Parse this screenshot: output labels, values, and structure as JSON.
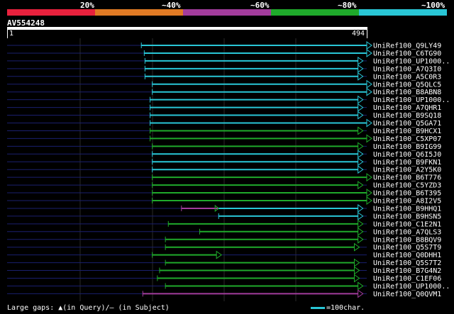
{
  "header": {
    "pct_labels": [
      "20%",
      "~40%",
      "~60%",
      "~80%",
      "~100%"
    ],
    "bands": [
      "#e8213d",
      "#e07a24",
      "#a23c9c",
      "#1faa2b",
      "#29c6d6"
    ]
  },
  "query": {
    "name": "AV554248",
    "start": "1",
    "end": "494",
    "length": 494
  },
  "colors": {
    "cyan": "#29c6d6",
    "green": "#1faa2b",
    "purple": "#a23c9c",
    "track": "#1a1f6e"
  },
  "hits": [
    {
      "name": "UniRef100_Q9LY49",
      "start": 185,
      "end": 494,
      "color": "cyan"
    },
    {
      "name": "UniRef100_C6TG90",
      "start": 189,
      "end": 494,
      "color": "cyan"
    },
    {
      "name": "UniRef100_UP1000..",
      "start": 190,
      "end": 482,
      "color": "cyan"
    },
    {
      "name": "UniRef100_A7Q3I0",
      "start": 190,
      "end": 482,
      "color": "cyan"
    },
    {
      "name": "UniRef100_A5C0R3",
      "start": 190,
      "end": 482,
      "color": "cyan"
    },
    {
      "name": "UniRef100_Q5QLC5",
      "start": 200,
      "end": 494,
      "color": "cyan"
    },
    {
      "name": "UniRef100_B8ABN8",
      "start": 200,
      "end": 494,
      "color": "cyan"
    },
    {
      "name": "UniRef100_UP1000..",
      "start": 197,
      "end": 482,
      "color": "cyan"
    },
    {
      "name": "UniRef100_A7QHR1",
      "start": 197,
      "end": 482,
      "color": "cyan"
    },
    {
      "name": "UniRef100_B9SQ18",
      "start": 197,
      "end": 482,
      "color": "cyan"
    },
    {
      "name": "UniRef100_Q5GA71",
      "start": 197,
      "end": 494,
      "color": "cyan"
    },
    {
      "name": "UniRef100_B9HCX1",
      "start": 197,
      "end": 482,
      "color": "green"
    },
    {
      "name": "UniRef100_C5XP07",
      "start": 197,
      "end": 494,
      "color": "green"
    },
    {
      "name": "UniRef100_B9IG99",
      "start": 200,
      "end": 482,
      "color": "green"
    },
    {
      "name": "UniRef100_Q6I5J0",
      "start": 200,
      "end": 482,
      "color": "cyan"
    },
    {
      "name": "UniRef100_B9FKN1",
      "start": 200,
      "end": 482,
      "color": "cyan"
    },
    {
      "name": "UniRef100_A2Y5K0",
      "start": 200,
      "end": 482,
      "color": "cyan"
    },
    {
      "name": "UniRef100_B6T776",
      "start": 200,
      "end": 494,
      "color": "green"
    },
    {
      "name": "UniRef100_C5YZD3",
      "start": 200,
      "end": 482,
      "color": "green"
    },
    {
      "name": "UniRef100_B6T395",
      "start": 200,
      "end": 494,
      "color": "green"
    },
    {
      "name": "UniRef100_A8I2V5",
      "start": 200,
      "end": 494,
      "color": "green"
    },
    {
      "name": "UniRef100_B9HHQ1",
      "start": 240,
      "end": 482,
      "color": "purple-cyan",
      "split": 291
    },
    {
      "name": "UniRef100_B9HSN5",
      "start": 291,
      "end": 482,
      "color": "cyan"
    },
    {
      "name": "UniRef100_C1E2N1",
      "start": 222,
      "end": 482,
      "color": "green"
    },
    {
      "name": "UniRef100_A7QLS3",
      "start": 265,
      "end": 482,
      "color": "green"
    },
    {
      "name": "UniRef100_B8BQV9",
      "start": 218,
      "end": 482,
      "color": "green"
    },
    {
      "name": "UniRef100_Q5S7T9",
      "start": 218,
      "end": 477,
      "color": "green"
    },
    {
      "name": "UniRef100_Q0DHH1",
      "start": 200,
      "end": 288,
      "color": "green"
    },
    {
      "name": "UniRef100_Q5S7T2",
      "start": 218,
      "end": 477,
      "color": "green"
    },
    {
      "name": "UniRef100_B7G4N2",
      "start": 210,
      "end": 477,
      "color": "green"
    },
    {
      "name": "UniRef100_C1EF06",
      "start": 207,
      "end": 477,
      "color": "green"
    },
    {
      "name": "UniRef100_UP1000..",
      "start": 218,
      "end": 482,
      "color": "green"
    },
    {
      "name": "UniRef100_Q0QVM1",
      "start": 187,
      "end": 482,
      "color": "purple"
    }
  ],
  "legend": {
    "text": "Large gaps: ▲(in Query)/– (in Subject)",
    "scale": "=100char."
  }
}
